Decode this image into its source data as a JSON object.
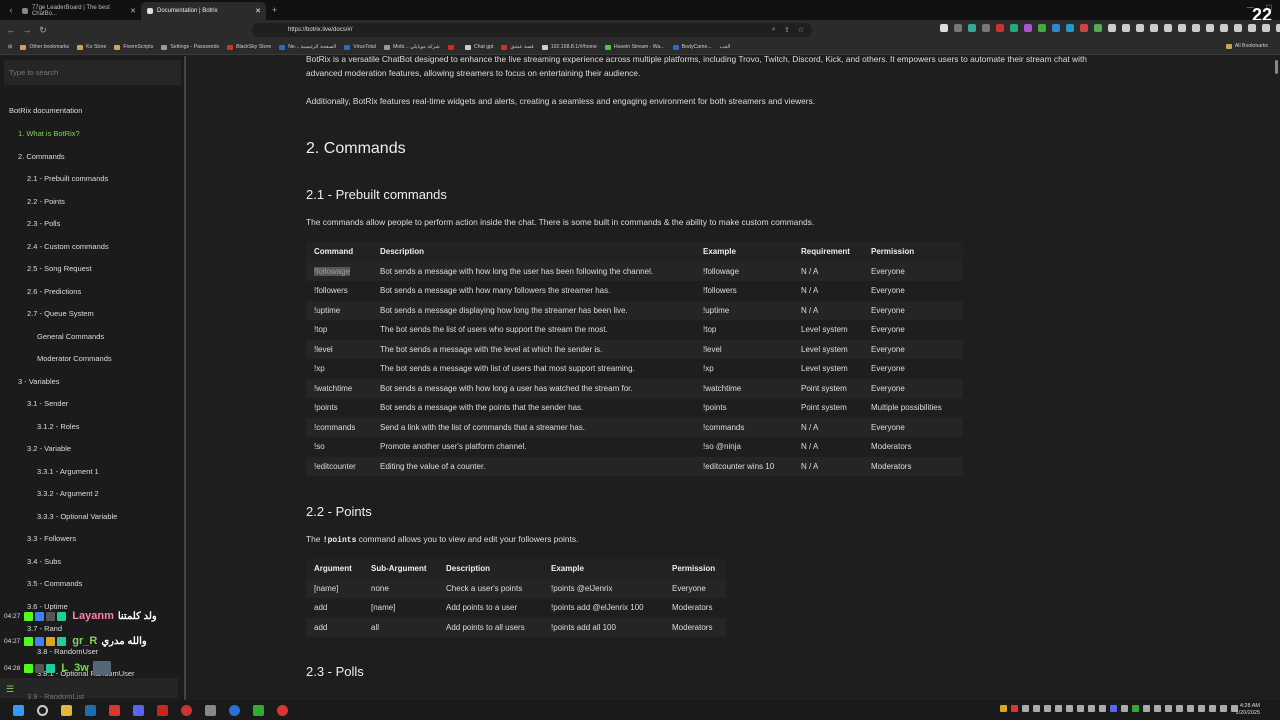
{
  "browser": {
    "tabs": [
      {
        "title": "77ge LeaderBoard | The best ChatBo..."
      },
      {
        "title": "Documentation | Botrix"
      }
    ],
    "url": "https://botrix.live/docs/#/",
    "bookmarks": [
      "Other bookmarks",
      "Ko Store",
      "FivemScripts",
      "Settings - Passwords",
      "BlackSky Store",
      "Ne... الصفحة الرئيسية",
      "VirusTotal",
      "Mobi... شركة موبايلي",
      "",
      "Chat gpt",
      "قصة عشق",
      "192.168.8.1/#/home",
      "Husein Stream - Wa...",
      "BodyCame...",
      "العب"
    ],
    "all_bookmarks": "All Bookmarks",
    "overlay_number": "22"
  },
  "sidebar": {
    "search_placeholder": "Type to search",
    "items": [
      {
        "label": "BotRix documentation"
      },
      {
        "label": "1. What is BotRix?"
      },
      {
        "label": "2. Commands"
      },
      {
        "label": "2.1 - Prebuilt commands"
      },
      {
        "label": "2.2 - Points"
      },
      {
        "label": "2.3 - Polls"
      },
      {
        "label": "2.4 - Custom commands"
      },
      {
        "label": "2.5 - Song Request"
      },
      {
        "label": "2.6 - Predictions"
      },
      {
        "label": "2.7 - Queue System"
      },
      {
        "label": "General Commands"
      },
      {
        "label": "Moderator Commands"
      },
      {
        "label": "3 - Variables"
      },
      {
        "label": "3.1 - Sender"
      },
      {
        "label": "3.1.2 - Roles"
      },
      {
        "label": "3.2 - Variable"
      },
      {
        "label": "3.3.1 - Argument 1"
      },
      {
        "label": "3.3.2 - Argument 2"
      },
      {
        "label": "3.3.3 - Optional Variable"
      },
      {
        "label": "3.3 - Followers"
      },
      {
        "label": "3.4 - Subs"
      },
      {
        "label": "3.5 - Commands"
      },
      {
        "label": "3.6 - Uptime"
      },
      {
        "label": "3.7 - Rand"
      },
      {
        "label": "3.8 - RandomUser"
      },
      {
        "label": "3.8.1 - Optional RandomUser"
      },
      {
        "label": "3.9 - RandomList"
      }
    ]
  },
  "chat": [
    {
      "time": "04:27",
      "user": "Layanm",
      "message": "ولد كلمتنا"
    },
    {
      "time": "04:27",
      "user": "gr_R",
      "message": "والله مدري"
    },
    {
      "time": "04:28",
      "user": "L_3w",
      "message": ""
    }
  ],
  "content": {
    "intro_p1_line1": "BotRix is a versatile ChatBot designed to enhance the live streaming experience across multiple platforms, including Trovo, Twitch, Discord, Kick, and others. It empowers users to automate their stream chat with",
    "intro_p1_line2": "advanced moderation features, allowing streamers to focus on entertaining their audience.",
    "intro_p2": "Additionally, BotRix features real-time widgets and alerts, creating a seamless and engaging environment for both streamers and viewers.",
    "commands_heading": "2. Commands",
    "prebuilt_heading": "2.1 - Prebuilt commands",
    "prebuilt_desc": "The commands allow people to perform action inside the chat. There is some built in commands & the ability to make custom commands.",
    "prebuilt_table": {
      "headers": [
        "Command",
        "Description",
        "Example",
        "Requirement",
        "Permission"
      ],
      "rows": [
        [
          "!followage",
          "Bot sends a message with how long the user has been following the channel.",
          "!followage",
          "N / A",
          "Everyone"
        ],
        [
          "!followers",
          "Bot sends a message with how many followers the streamer has.",
          "!followers",
          "N / A",
          "Everyone"
        ],
        [
          "!uptime",
          "Bot sends a message displaying how long the streamer has been live.",
          "!uptime",
          "N / A",
          "Everyone"
        ],
        [
          "!top",
          "The bot sends the list of users who support the stream the most.",
          "!top",
          "Level system",
          "Everyone"
        ],
        [
          "!level",
          "The bot sends a message with the level at which the sender is.",
          "!level",
          "Level system",
          "Everyone"
        ],
        [
          "!xp",
          "The bot sends a message with list of users that most support streaming.",
          "!xp",
          "Level system",
          "Everyone"
        ],
        [
          "!watchtime",
          "Bot sends a message with how long a user has watched the stream for.",
          "!watchtime",
          "Point system",
          "Everyone"
        ],
        [
          "!points",
          "Bot sends a message with the points that the sender has.",
          "!points",
          "Point system",
          "Multiple possibilities"
        ],
        [
          "!commands",
          "Send a link with the list of commands that a streamer has.",
          "!commands",
          "N / A",
          "Everyone"
        ],
        [
          "!so",
          "Promote another user's platform channel.",
          "!so @ninja",
          "N / A",
          "Moderators"
        ],
        [
          "!editcounter",
          "Editing the value of a counter.",
          "!editcounter wins 10",
          "N / A",
          "Moderators"
        ]
      ]
    },
    "points_heading": "2.2 - Points",
    "points_desc_pre": "The",
    "points_desc_code": "!points",
    "points_desc_post": "command allows you to view and edit your followers points.",
    "points_table": {
      "headers": [
        "Argument",
        "Sub-Argument",
        "Description",
        "Example",
        "Permission"
      ],
      "rows": [
        [
          "[name]",
          "none",
          "Check a user's points",
          "!points @elJenrix",
          "Everyone"
        ],
        [
          "add",
          "[name]",
          "Add points to a user",
          "!points add @elJenrix 100",
          "Moderators"
        ],
        [
          "add",
          "all",
          "Add points to all users",
          "!points add all 100",
          "Moderators"
        ]
      ]
    },
    "polls_heading": "2.3 - Polls"
  },
  "taskbar": {
    "time": "4:28 AM",
    "date": "1/20/2025"
  }
}
